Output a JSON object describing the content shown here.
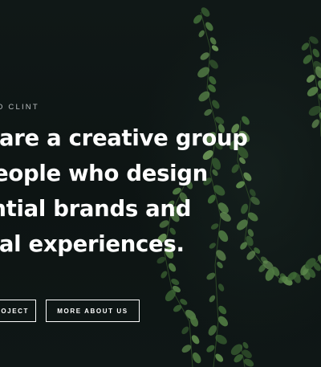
{
  "hero": {
    "eyebrow": "O CLINT",
    "headline_lines": [
      "are a creative group",
      "eople who design",
      "ential brands and",
      "tal experiences."
    ],
    "buttons": {
      "primary_label": "OJECT",
      "secondary_label": "MORE ABOUT US"
    },
    "background": "dark-leaf-vines-photo"
  },
  "colors": {
    "background": "#0e1514",
    "text": "#ffffff",
    "eyebrow": "#b9bec0",
    "leaf": "#4f7a42"
  }
}
